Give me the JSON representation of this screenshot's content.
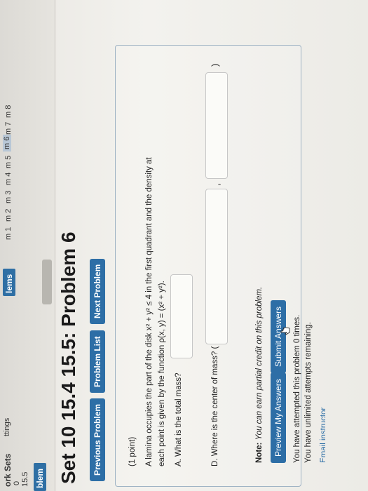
{
  "sidebar": {
    "items": [
      {
        "label": "ork Sets"
      },
      {
        "label": "0"
      },
      {
        "label": "15.5"
      },
      {
        "label": "blem"
      },
      {
        "label": "ttings"
      },
      {
        "label": "lems"
      },
      {
        "label": "m 1"
      },
      {
        "label": "m 2"
      },
      {
        "label": "m 3"
      },
      {
        "label": "m 4"
      },
      {
        "label": "m 5"
      },
      {
        "label": "m 6"
      },
      {
        "label": "m 7"
      },
      {
        "label": "m 8"
      }
    ]
  },
  "page": {
    "title": "Set 10 15.4 15.5: Problem 6"
  },
  "nav": {
    "previous": "Previous Problem",
    "list": "Problem List",
    "next": "Next Problem"
  },
  "problem": {
    "points": "(1 point)",
    "line1": "A lamina occupies the part of the disk x² + y² ≤ 4 in the first quadrant and the density at",
    "line2": "each point is given by the function ρ(x, y) = (x² + y²).",
    "partA": "A. What is the total mass?",
    "partD": "D. Where is the center of mass? (",
    "comma": ",",
    "close_paren": ")"
  },
  "note": {
    "label": "Note:",
    "text": "You can earn partial credit on this problem."
  },
  "actions": {
    "preview": "Preview My Answers",
    "submit": "Submit Answers"
  },
  "status": {
    "attempts": "You have attempted this problem 0 times.",
    "remaining": "You have unlimited attempts remaining."
  },
  "footer": {
    "email": "Email instructor"
  }
}
